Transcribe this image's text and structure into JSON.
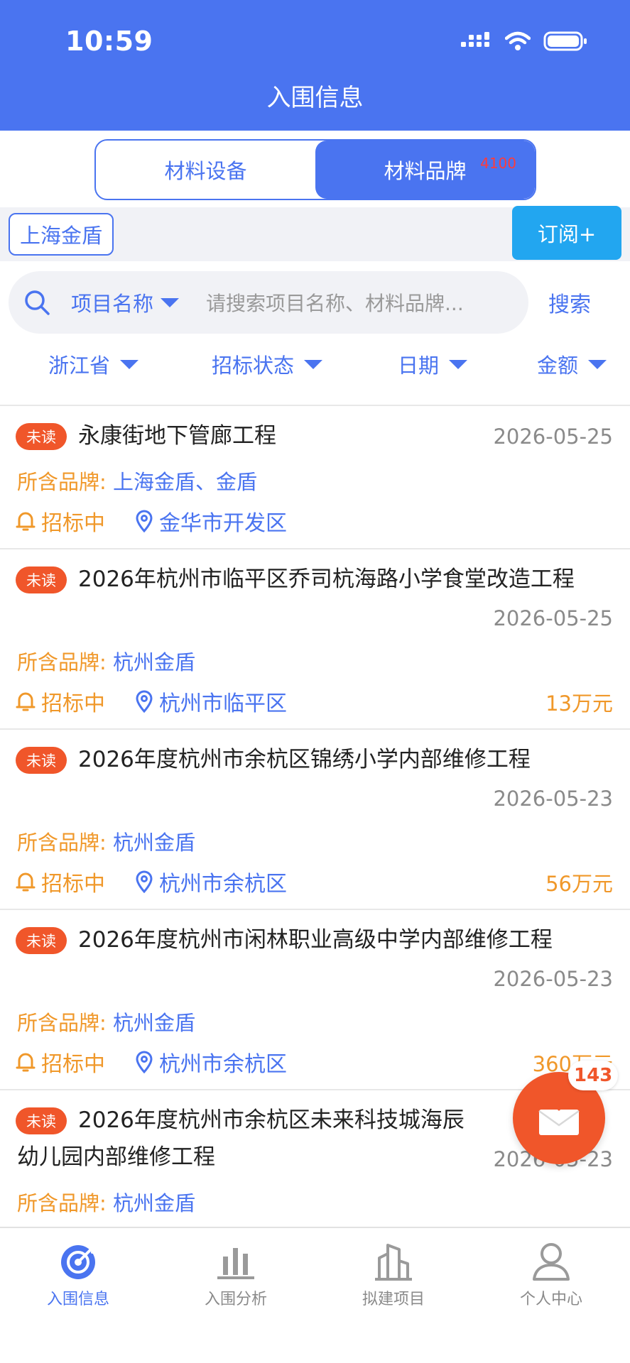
{
  "status_bar": {
    "time": "10:59"
  },
  "header": {
    "title": "入围信息"
  },
  "segment": {
    "tabs": [
      {
        "label": "材料设备",
        "active": false
      },
      {
        "label": "材料品牌",
        "active": true,
        "badge": "4100"
      }
    ]
  },
  "subscription": {
    "tag": "上海金盾",
    "button": "订阅+"
  },
  "search": {
    "type_label": "项目名称",
    "placeholder": "请搜索项目名称、材料品牌...",
    "button": "搜索"
  },
  "filters": [
    "浙江省",
    "招标状态",
    "日期",
    "金额"
  ],
  "list": {
    "items": [
      {
        "unread": "未读",
        "title": "永康街地下管廊工程",
        "date": "2026-05-25",
        "brand_label": "所含品牌:",
        "brands": "上海金盾、金盾",
        "status": "招标中",
        "location": "金华市开发区",
        "amount": ""
      },
      {
        "unread": "未读",
        "title": "2026年杭州市临平区乔司杭海路小学食堂改造工程",
        "date": "2026-05-25",
        "brand_label": "所含品牌:",
        "brands": "杭州金盾",
        "status": "招标中",
        "location": "杭州市临平区",
        "amount": "13万元"
      },
      {
        "unread": "未读",
        "title": "2026年度杭州市余杭区锦绣小学内部维修工程",
        "date": "2026-05-23",
        "brand_label": "所含品牌:",
        "brands": "杭州金盾",
        "status": "招标中",
        "location": "杭州市余杭区",
        "amount": "56万元"
      },
      {
        "unread": "未读",
        "title": "2026年度杭州市闲林职业高级中学内部维修工程",
        "date": "2026-05-23",
        "brand_label": "所含品牌:",
        "brands": "杭州金盾",
        "status": "招标中",
        "location": "杭州市余杭区",
        "amount": "360万元"
      },
      {
        "unread": "未读",
        "title": "2026年度杭州市余杭区未来科技城海辰幼儿园内部维修工程",
        "date": "2026-05-23",
        "brand_label": "所含品牌:",
        "brands": "杭州金盾",
        "status": "",
        "location": "",
        "amount": ""
      }
    ]
  },
  "mail": {
    "badge": "143"
  },
  "tabbar": {
    "tabs": [
      {
        "label": "入围信息",
        "icon": "target-icon",
        "active": true
      },
      {
        "label": "入围分析",
        "icon": "bar-chart-icon",
        "active": false
      },
      {
        "label": "拟建项目",
        "icon": "building-icon",
        "active": false
      },
      {
        "label": "个人中心",
        "icon": "user-icon",
        "active": false
      }
    ]
  },
  "colors": {
    "primary": "#4a74f0",
    "accent": "#f0982a",
    "unread": "#f0562a",
    "subscribe": "#22a6f0"
  }
}
